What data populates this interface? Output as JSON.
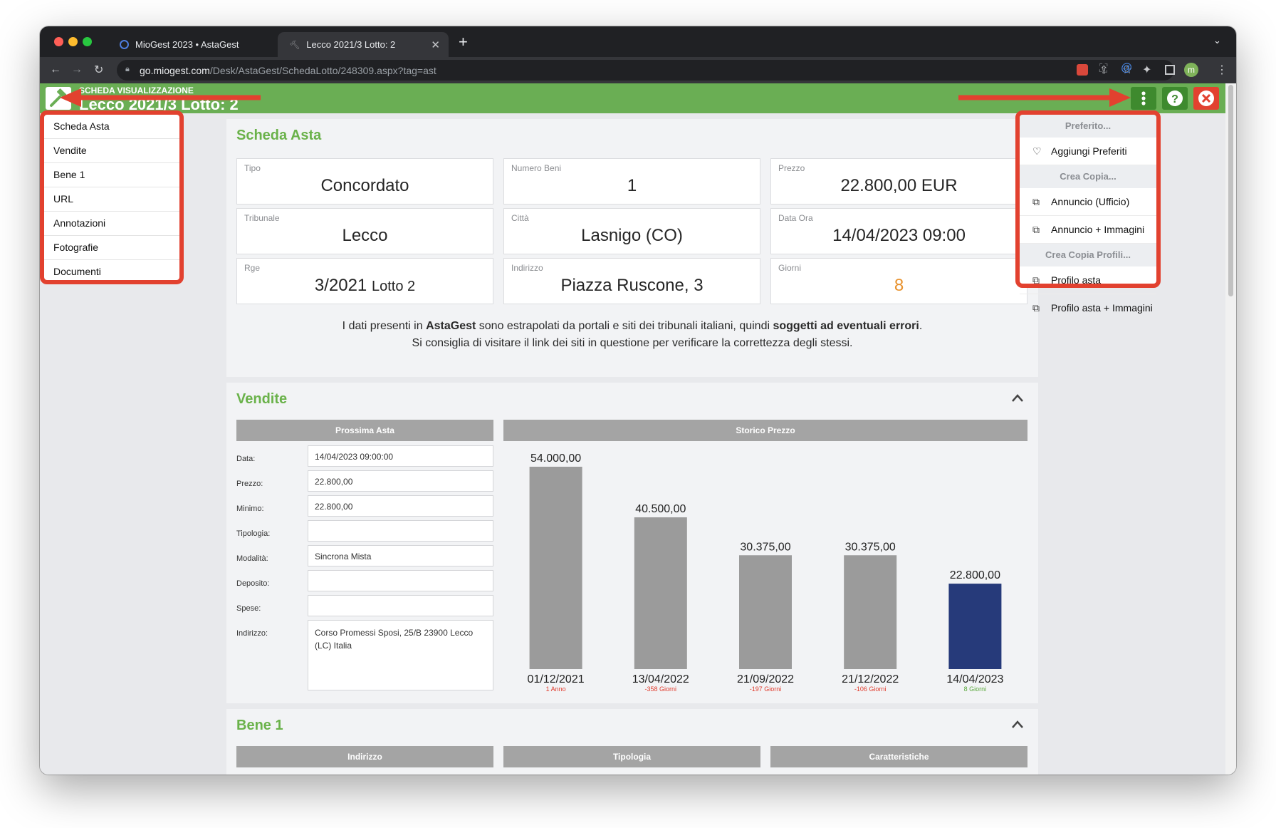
{
  "browser": {
    "tabs": [
      {
        "label": "MioGest 2023 • AstaGest"
      },
      {
        "label": "Lecco 2021/3 Lotto: 2"
      }
    ],
    "new_tab": "+",
    "url_domain": "go.miogest.com",
    "url_path": "/Desk/AstaGest/SchedaLotto/248309.aspx?tag=ast"
  },
  "header": {
    "subtitle": "SCHEDA VISUALIZZAZIONE",
    "title": "Lecco 2021/3 Lotto: 2"
  },
  "sidebar": {
    "items": [
      {
        "label": "Scheda Asta"
      },
      {
        "label": "Vendite"
      },
      {
        "label": "Bene 1"
      },
      {
        "label": "URL"
      },
      {
        "label": "Annotazioni"
      },
      {
        "label": "Fotografie"
      },
      {
        "label": "Documenti"
      }
    ]
  },
  "scheda": {
    "title": "Scheda Asta",
    "cards": [
      {
        "label": "Tipo",
        "value": "Concordato"
      },
      {
        "label": "Numero Beni",
        "value": "1"
      },
      {
        "label": "Prezzo",
        "value": "22.800,00 EUR"
      },
      {
        "label": "Tribunale",
        "value": "Lecco"
      },
      {
        "label": "Città",
        "value": "Lasnigo (CO)"
      },
      {
        "label": "Data Ora",
        "value": "14/04/2023 09:00"
      },
      {
        "label": "Rge",
        "value": "3/2021",
        "suffix": "Lotto 2"
      },
      {
        "label": "Indirizzo",
        "value": "Piazza Ruscone, 3"
      },
      {
        "label": "Giorni",
        "value": "8"
      }
    ],
    "notice": {
      "p1": "I dati presenti in ",
      "b1": "AstaGest",
      "p2": " sono estrapolati da portali e siti dei tribunali italiani, quindi ",
      "b2": "soggetti ad eventuali errori",
      "p3": ".",
      "line2": "Si consiglia di visitare il link dei siti in questione per verificare la correttezza degli stessi."
    },
    "giorni_color": "#e8912c"
  },
  "vendite": {
    "title": "Vendite",
    "prossima": {
      "header": "Prossima Asta",
      "fields": [
        {
          "label": "Data:",
          "value": "14/04/2023 09:00:00"
        },
        {
          "label": "Prezzo:",
          "value": "22.800,00"
        },
        {
          "label": "Minimo:",
          "value": "22.800,00"
        },
        {
          "label": "Tipologia:",
          "value": ""
        },
        {
          "label": "Modalità:",
          "value": "Sincrona Mista"
        },
        {
          "label": "Deposito:",
          "value": ""
        },
        {
          "label": "Spese:",
          "value": ""
        },
        {
          "label": "Indirizzo:",
          "value": "Corso Promessi Sposi, 25/B 23900 Lecco (LC) Italia"
        }
      ]
    },
    "storico_header": "Storico Prezzo"
  },
  "chart_data": {
    "type": "bar",
    "categories": [
      "01/12/2021",
      "13/04/2022",
      "21/09/2022",
      "21/12/2022",
      "14/04/2023"
    ],
    "values": [
      54000,
      40500,
      30375,
      30375,
      22800
    ],
    "value_labels": [
      "54.000,00",
      "40.500,00",
      "30.375,00",
      "30.375,00",
      "22.800,00"
    ],
    "sub_labels": [
      "1 Anno",
      "-358 Giorni",
      "-197 Giorni",
      "-106 Giorni",
      "8 Giorni"
    ],
    "sub_label_colors": [
      "#e03a2b",
      "#e03a2b",
      "#e03a2b",
      "#e03a2b",
      "#5aa83c"
    ],
    "bar_colors": [
      "#9b9b9b",
      "#9b9b9b",
      "#9b9b9b",
      "#9b9b9b",
      "#263a7a"
    ],
    "title": "Storico Prezzo",
    "ylim": [
      0,
      54000
    ]
  },
  "bene": {
    "title": "Bene 1",
    "columns": [
      "Indirizzo",
      "Tipologia",
      "Caratteristiche"
    ]
  },
  "dropdown": {
    "sections": [
      {
        "header": "Preferito...",
        "items": [
          {
            "label": "Aggiungi Preferiti",
            "icon": "heart-icon"
          }
        ]
      },
      {
        "header": "Crea Copia...",
        "items": [
          {
            "label": "Annuncio (Ufficio)",
            "icon": "copy-icon"
          },
          {
            "label": "Annuncio + Immagini",
            "icon": "copy-icon"
          }
        ]
      },
      {
        "header": "Crea Copia Profili...",
        "items": [
          {
            "label": "Profilo asta",
            "icon": "copy-icon"
          },
          {
            "label": "Profilo asta + Immagini",
            "icon": "copy-icon"
          }
        ]
      }
    ]
  },
  "colors": {
    "brand_green": "#6aae54",
    "section_green": "#6ab24a",
    "annotation_red": "#e2412f",
    "close_red": "#e2412f"
  }
}
